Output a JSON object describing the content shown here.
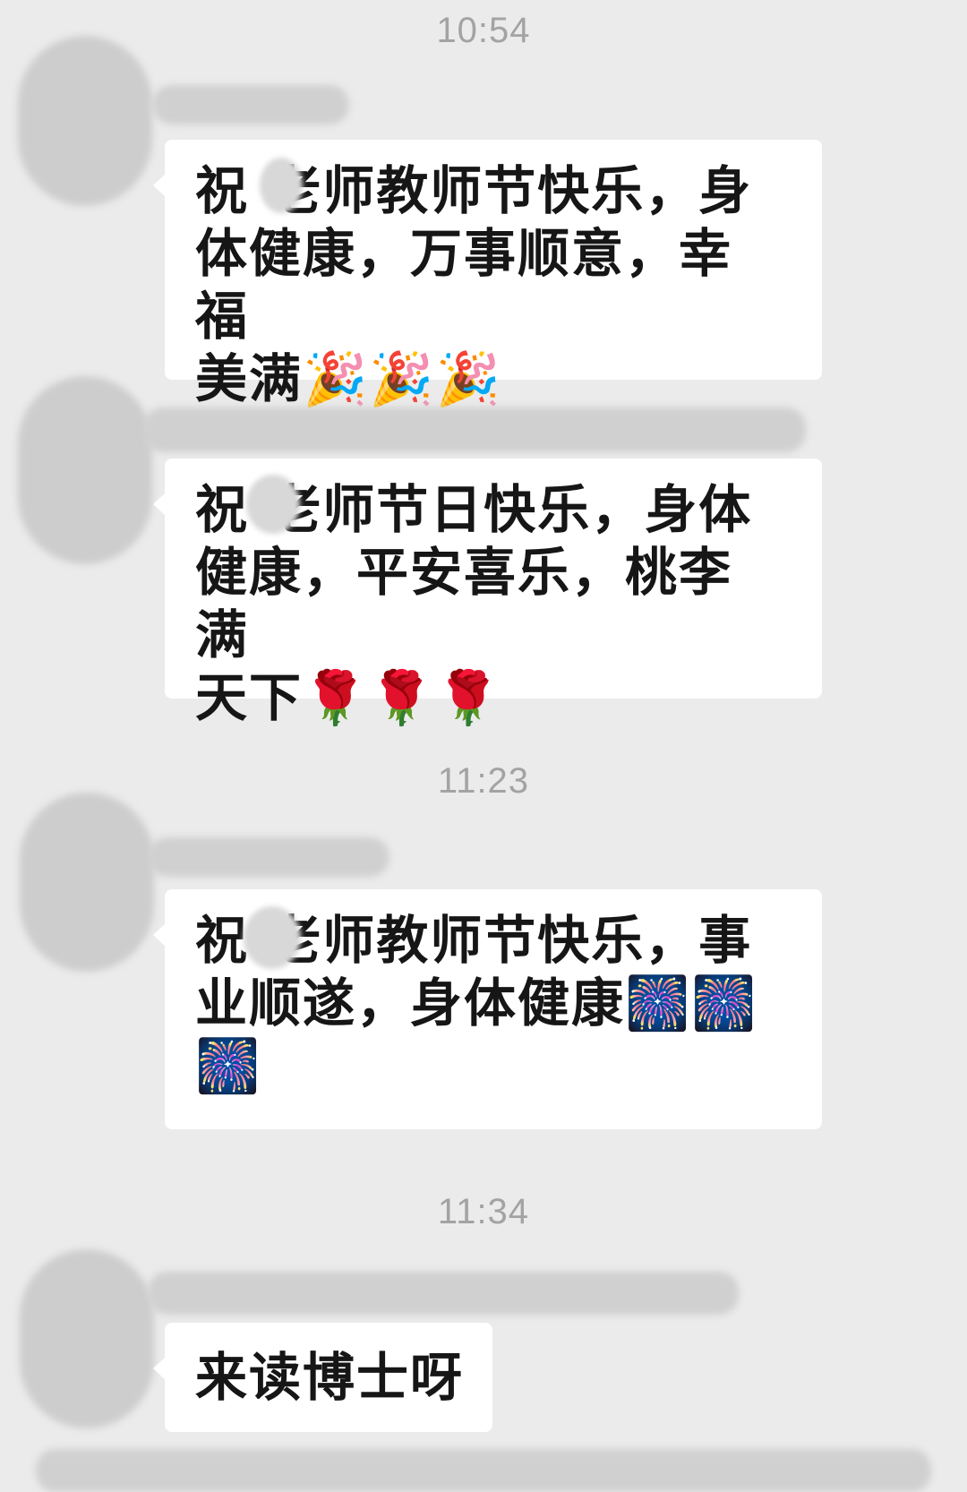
{
  "timestamps": [
    "10:54",
    "11:23",
    "11:34"
  ],
  "messages": [
    {
      "text": "祝老师教师节快乐，身体健康，万事顺意，幸福美满",
      "line1": "祝 老师教师节快乐，身",
      "line2": "体健康，万事顺意，幸福",
      "line3": "美满",
      "emoji": "🎉🎉🎉"
    },
    {
      "text": "祝老师节日快乐，身体健康，平安喜乐，桃李满天下",
      "line1": "祝 老师节日快乐，身体",
      "line2": "健康，平安喜乐，桃李满",
      "line3": "天下",
      "emoji": "🌹🌹🌹"
    },
    {
      "text": "祝老师教师节快乐，事业顺遂，身体健康",
      "line1": "祝 老师教师节快乐，事",
      "line2": "业顺遂，身体健康",
      "line2_emoji": "🎆🎆",
      "line3_emoji": "🎆"
    },
    {
      "text": "来读博士呀"
    }
  ]
}
